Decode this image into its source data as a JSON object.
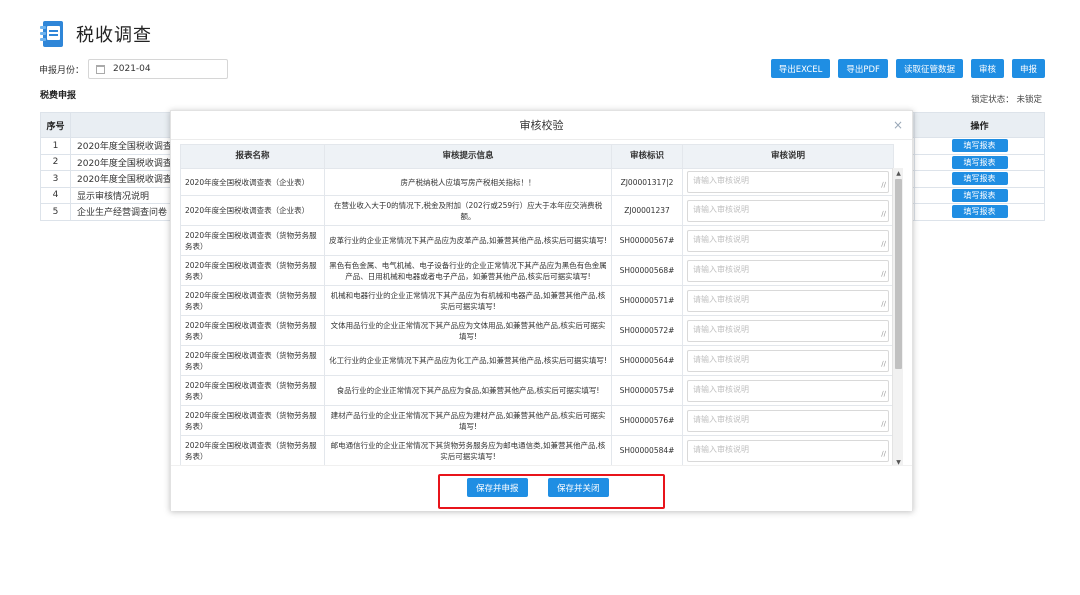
{
  "header": {
    "title": "税收调查",
    "month_label": "申报月份：",
    "month_value": "2021-04"
  },
  "toolbar": {
    "export_excel": "导出EXCEL",
    "export_pdf": "导出PDF",
    "fetch_data": "读取征管数据",
    "review": "审核",
    "declare": "申报"
  },
  "section": {
    "title": "税费申报",
    "lock_status": "锁定状态： 未锁定"
  },
  "bg_table": {
    "headers": {
      "index": "序号",
      "operation": "操作"
    },
    "rows": [
      {
        "index": "1",
        "name": "2020年度全国税收调查",
        "action": "填写报表"
      },
      {
        "index": "2",
        "name": "2020年度全国税收调查",
        "action": "填写报表"
      },
      {
        "index": "3",
        "name": "2020年度全国税收调查",
        "action": "填写报表"
      },
      {
        "index": "4",
        "name": "显示审核情况说明",
        "action": "填写报表"
      },
      {
        "index": "5",
        "name": "企业生产经营调查问卷",
        "action": "填写报表"
      }
    ]
  },
  "modal": {
    "title": "审核校验",
    "close": "×",
    "headers": {
      "name": "报表名称",
      "info": "审核提示信息",
      "code": "审核标识",
      "desc": "审核说明"
    },
    "desc_placeholder": "请输入审核说明",
    "rows": [
      {
        "name": "2020年度全国税收调查表（企业表）",
        "info": "房产税纳税人应填写房产税相关指标！！",
        "code": "ZJ00001317|2"
      },
      {
        "name": "2020年度全国税收调查表（企业表）",
        "info": "在营业收入大于0的情况下,税金及附加（202行或259行）应大于本年应交消费税额。",
        "code": "ZJ00001237"
      },
      {
        "name": "2020年度全国税收调查表（货物劳务服务表）",
        "info": "皮革行业的企业正常情况下其产品应为皮革产品,如兼营其他产品,核实后可据实填写!",
        "code": "SH00000567#"
      },
      {
        "name": "2020年度全国税收调查表（货物劳务服务表）",
        "info": "黑色有色金属、电气机械、电子设备行业的企业正常情况下其产品应为黑色有色金属产品、日用机械和电器或者电子产品，如兼营其他产品,核实后可据实填写!",
        "code": "SH00000568#"
      },
      {
        "name": "2020年度全国税收调查表（货物劳务服务表）",
        "info": "机械和电器行业的企业正常情况下其产品应为有机械和电器产品,如兼营其他产品,核实后可据实填写!",
        "code": "SH00000571#"
      },
      {
        "name": "2020年度全国税收调查表（货物劳务服务表）",
        "info": "文体用品行业的企业正常情况下其产品应为文体用品,如兼营其他产品,核实后可据实填写!",
        "code": "SH00000572#"
      },
      {
        "name": "2020年度全国税收调查表（货物劳务服务表）",
        "info": "化工行业的企业正常情况下其产品应为化工产品,如兼营其他产品,核实后可据实填写!",
        "code": "SH00000564#"
      },
      {
        "name": "2020年度全国税收调查表（货物劳务服务表）",
        "info": "食品行业的企业正常情况下其产品应为食品,如兼营其他产品,核实后可据实填写!",
        "code": "SH00000575#"
      },
      {
        "name": "2020年度全国税收调查表（货物劳务服务表）",
        "info": "建材产品行业的企业正常情况下其产品应为建材产品,如兼营其他产品,核实后可据实填写!",
        "code": "SH00000576#"
      },
      {
        "name": "2020年度全国税收调查表（货物劳务服务表）",
        "info": "邮电通信行业的企业正常情况下其货物劳务服务应为邮电通信类,如兼营其他产品,核实后可据实填写!",
        "code": "SH00000584#"
      }
    ],
    "save_declare": "保存并申报",
    "save_close": "保存并关闭"
  },
  "colors": {
    "primary": "#1f8ee3",
    "highlight": "#e8141b",
    "header_bg": "#eef2f6"
  }
}
